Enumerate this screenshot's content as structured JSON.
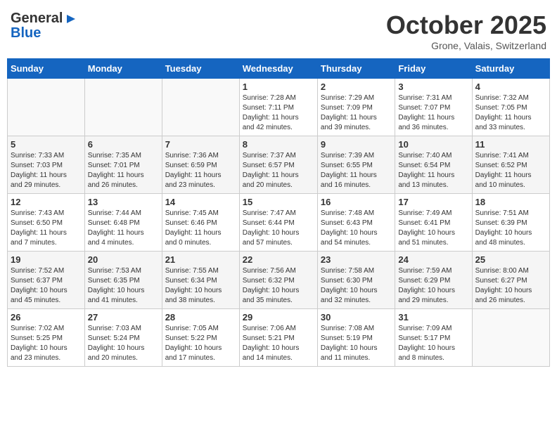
{
  "header": {
    "logo_general": "General",
    "logo_blue": "Blue",
    "month": "October 2025",
    "location": "Grone, Valais, Switzerland"
  },
  "days_of_week": [
    "Sunday",
    "Monday",
    "Tuesday",
    "Wednesday",
    "Thursday",
    "Friday",
    "Saturday"
  ],
  "weeks": [
    [
      {
        "num": "",
        "info": ""
      },
      {
        "num": "",
        "info": ""
      },
      {
        "num": "",
        "info": ""
      },
      {
        "num": "1",
        "info": "Sunrise: 7:28 AM\nSunset: 7:11 PM\nDaylight: 11 hours\nand 42 minutes."
      },
      {
        "num": "2",
        "info": "Sunrise: 7:29 AM\nSunset: 7:09 PM\nDaylight: 11 hours\nand 39 minutes."
      },
      {
        "num": "3",
        "info": "Sunrise: 7:31 AM\nSunset: 7:07 PM\nDaylight: 11 hours\nand 36 minutes."
      },
      {
        "num": "4",
        "info": "Sunrise: 7:32 AM\nSunset: 7:05 PM\nDaylight: 11 hours\nand 33 minutes."
      }
    ],
    [
      {
        "num": "5",
        "info": "Sunrise: 7:33 AM\nSunset: 7:03 PM\nDaylight: 11 hours\nand 29 minutes."
      },
      {
        "num": "6",
        "info": "Sunrise: 7:35 AM\nSunset: 7:01 PM\nDaylight: 11 hours\nand 26 minutes."
      },
      {
        "num": "7",
        "info": "Sunrise: 7:36 AM\nSunset: 6:59 PM\nDaylight: 11 hours\nand 23 minutes."
      },
      {
        "num": "8",
        "info": "Sunrise: 7:37 AM\nSunset: 6:57 PM\nDaylight: 11 hours\nand 20 minutes."
      },
      {
        "num": "9",
        "info": "Sunrise: 7:39 AM\nSunset: 6:55 PM\nDaylight: 11 hours\nand 16 minutes."
      },
      {
        "num": "10",
        "info": "Sunrise: 7:40 AM\nSunset: 6:54 PM\nDaylight: 11 hours\nand 13 minutes."
      },
      {
        "num": "11",
        "info": "Sunrise: 7:41 AM\nSunset: 6:52 PM\nDaylight: 11 hours\nand 10 minutes."
      }
    ],
    [
      {
        "num": "12",
        "info": "Sunrise: 7:43 AM\nSunset: 6:50 PM\nDaylight: 11 hours\nand 7 minutes."
      },
      {
        "num": "13",
        "info": "Sunrise: 7:44 AM\nSunset: 6:48 PM\nDaylight: 11 hours\nand 4 minutes."
      },
      {
        "num": "14",
        "info": "Sunrise: 7:45 AM\nSunset: 6:46 PM\nDaylight: 11 hours\nand 0 minutes."
      },
      {
        "num": "15",
        "info": "Sunrise: 7:47 AM\nSunset: 6:44 PM\nDaylight: 10 hours\nand 57 minutes."
      },
      {
        "num": "16",
        "info": "Sunrise: 7:48 AM\nSunset: 6:43 PM\nDaylight: 10 hours\nand 54 minutes."
      },
      {
        "num": "17",
        "info": "Sunrise: 7:49 AM\nSunset: 6:41 PM\nDaylight: 10 hours\nand 51 minutes."
      },
      {
        "num": "18",
        "info": "Sunrise: 7:51 AM\nSunset: 6:39 PM\nDaylight: 10 hours\nand 48 minutes."
      }
    ],
    [
      {
        "num": "19",
        "info": "Sunrise: 7:52 AM\nSunset: 6:37 PM\nDaylight: 10 hours\nand 45 minutes."
      },
      {
        "num": "20",
        "info": "Sunrise: 7:53 AM\nSunset: 6:35 PM\nDaylight: 10 hours\nand 41 minutes."
      },
      {
        "num": "21",
        "info": "Sunrise: 7:55 AM\nSunset: 6:34 PM\nDaylight: 10 hours\nand 38 minutes."
      },
      {
        "num": "22",
        "info": "Sunrise: 7:56 AM\nSunset: 6:32 PM\nDaylight: 10 hours\nand 35 minutes."
      },
      {
        "num": "23",
        "info": "Sunrise: 7:58 AM\nSunset: 6:30 PM\nDaylight: 10 hours\nand 32 minutes."
      },
      {
        "num": "24",
        "info": "Sunrise: 7:59 AM\nSunset: 6:29 PM\nDaylight: 10 hours\nand 29 minutes."
      },
      {
        "num": "25",
        "info": "Sunrise: 8:00 AM\nSunset: 6:27 PM\nDaylight: 10 hours\nand 26 minutes."
      }
    ],
    [
      {
        "num": "26",
        "info": "Sunrise: 7:02 AM\nSunset: 5:25 PM\nDaylight: 10 hours\nand 23 minutes."
      },
      {
        "num": "27",
        "info": "Sunrise: 7:03 AM\nSunset: 5:24 PM\nDaylight: 10 hours\nand 20 minutes."
      },
      {
        "num": "28",
        "info": "Sunrise: 7:05 AM\nSunset: 5:22 PM\nDaylight: 10 hours\nand 17 minutes."
      },
      {
        "num": "29",
        "info": "Sunrise: 7:06 AM\nSunset: 5:21 PM\nDaylight: 10 hours\nand 14 minutes."
      },
      {
        "num": "30",
        "info": "Sunrise: 7:08 AM\nSunset: 5:19 PM\nDaylight: 10 hours\nand 11 minutes."
      },
      {
        "num": "31",
        "info": "Sunrise: 7:09 AM\nSunset: 5:17 PM\nDaylight: 10 hours\nand 8 minutes."
      },
      {
        "num": "",
        "info": ""
      }
    ]
  ]
}
